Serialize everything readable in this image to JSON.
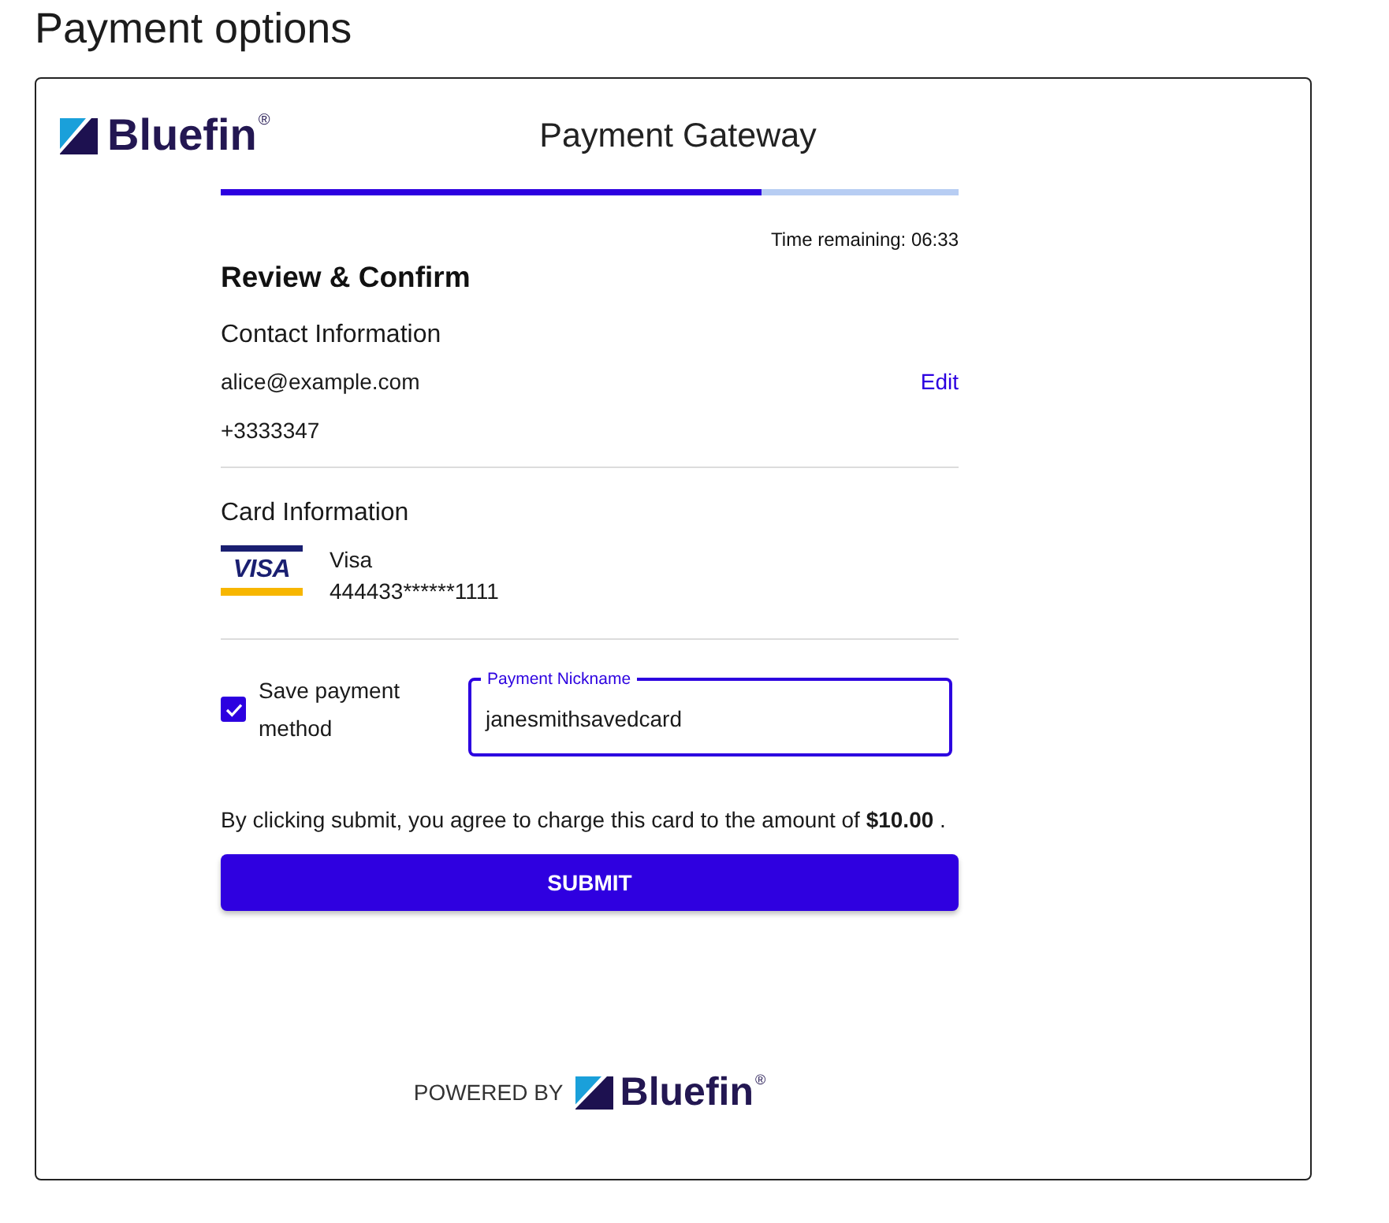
{
  "page": {
    "title": "Payment options"
  },
  "header": {
    "logo": "Bluefin$^{®}$",
    "title": "Payment Gateway"
  },
  "progress": {
    "level": 0.733
  },
  "timer": "Time remaining: 06:33",
  "review": {
    "heading": "Review & Confirm",
    "contact": {
      "heading": "Contact Information",
      "email": "alice@example.com",
      "edit": "Edit",
      "phone": "+3333347"
    },
    "card": {
      "heading": "Card Information",
      "logo": "VISA",
      "brand": "Visa",
      "number": "444433******1111"
    },
    "save": {
      "label": "Save payment method",
      "checked": true
    },
    "nickname": {
      "label": "Payment Nickname",
      "value": "janesmithsavedcard",
      "focused": true
    },
    "agreement": "By clicking submit, you agree to charge this card to the amount of **$10.00** .",
    "submit": "SUBMIT"
  },
  "footer": {
    "powered_by": "POWERED BY",
    "logo": "Bluefin$^{®}$"
  }
}
